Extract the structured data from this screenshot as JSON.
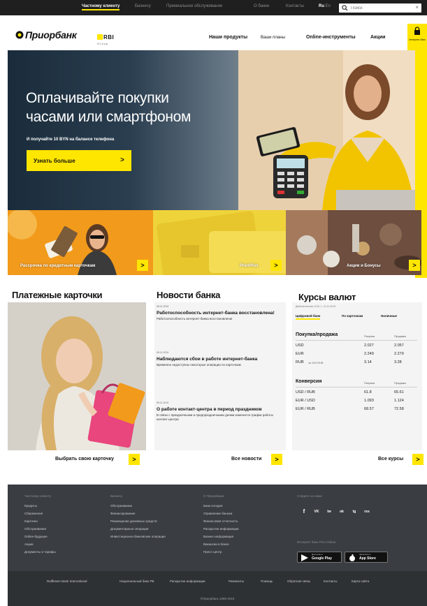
{
  "topbar": {
    "links": [
      "Частному клиенту",
      "Бизнесу",
      "Премиальное обслуживание",
      "О банке",
      "Контакты"
    ],
    "lang": [
      "Ru",
      "En"
    ],
    "search_placeholder": "Поиск",
    "close": "×"
  },
  "brand": {
    "name": "Приорбанк",
    "partner": "RBI",
    "partner_sub": "Group"
  },
  "nav": {
    "items": [
      "Наши продукты",
      "Ваши планы",
      "Online-инструменты",
      "Акции"
    ],
    "cabinet": "Интернет-банк"
  },
  "hero": {
    "title_line1": "Оплачивайте покупки",
    "title_line2": "часами или смартфоном",
    "subtitle": "И получайте 10 BYN на балансе телефона",
    "cta": "Узнать больше",
    "arrow": ">"
  },
  "tiles": [
    {
      "label": "Рассрочка по кредитным карточкам",
      "arrow": ">"
    },
    {
      "label": "PriorPlus",
      "arrow": ">"
    },
    {
      "label": "Акции и Бонусы",
      "arrow": ">"
    }
  ],
  "cards": {
    "title": "Платежные карточки",
    "link": "Выбрать свою карточку",
    "arrow": ">"
  },
  "news": {
    "title": "Новости банка",
    "items": [
      {
        "date": "06.11.2019",
        "title": "Работоспособность интернет-банка восстановлена!",
        "text": "Работоспособность интернет-банка восстановлена!"
      },
      {
        "date": "06.11.2019",
        "title": "Наблюдаются сбои в работе интернет-банка",
        "text": "Временно недоступны некоторые операции по карточкам"
      },
      {
        "date": "05.11.2019",
        "title": "О работе контакт-центра в период праздников",
        "text": "В связи с праздничными и предпраздничными днями изменится график работы контакт-центра"
      }
    ],
    "link": "Все новости",
    "arrow": ">"
  },
  "rates": {
    "title": "Курсы валют",
    "updated": "Действительны: 8:30, 1, 10.11.2019",
    "tabs": [
      "Цифровой банк",
      "По карточкам",
      "Наличные"
    ],
    "buy_sell": {
      "head": "Покупка/продажа",
      "col_buy": "Покупка",
      "col_sell": "Продажа",
      "rows": [
        {
          "cur": "USD",
          "note": "",
          "buy": "2.027",
          "sell": "2.057"
        },
        {
          "cur": "EUR",
          "note": "",
          "buy": "2.249",
          "sell": "2.279"
        },
        {
          "cur": "RUB",
          "note": "за 100 RUB",
          "buy": "3.14",
          "sell": "3.28"
        }
      ]
    },
    "conversion": {
      "head": "Конверсия",
      "col_buy": "Покупка",
      "col_sell": "Продажа",
      "rows": [
        {
          "pair": "USD / RUB",
          "buy": "61.8",
          "sell": "65.61"
        },
        {
          "pair": "EUR / USD",
          "buy": "1.093",
          "sell": "1.124"
        },
        {
          "pair": "EUR / RUB",
          "buy": "68.57",
          "sell": "72.58"
        }
      ]
    },
    "link": "Все курсы",
    "arrow": ">"
  },
  "footer": {
    "col1": {
      "head": "Частному клиенту",
      "links": [
        "Кредиты",
        "Сбережения",
        "Карточки",
        "Обслуживание",
        "Online-будущее",
        "Акции",
        "Документы и тарифы"
      ]
    },
    "col2": {
      "head": "Бизнесу",
      "links": [
        "Обслуживание",
        "Финансирование",
        "Размещение денежных средств",
        "Документарные операции",
        "Инвестиционно-банковские операции"
      ]
    },
    "col3": {
      "head": "О Приорбанке",
      "links": [
        "Банк сегодня",
        "Управление банком",
        "Финансовая отчетность",
        "Раскрытие информации",
        "Бизнес-информация",
        "Вакансии в банке",
        "Пресс-центр"
      ]
    },
    "col4": {
      "head": "Следите за нами",
      "apps_head": "Интернет банк Prior Online",
      "social": [
        "f",
        "VK",
        "tw",
        "ok",
        "tg",
        "rss"
      ]
    },
    "stores": [
      {
        "small": "Доступно в",
        "big": "Google Play"
      },
      {
        "small": "Загрузите в",
        "big": "App Store"
      }
    ],
    "bottom_links": [
      "Raiffeisen Bank International",
      "Национальный банк РБ",
      "Раскрытие информации",
      "Реквизиты",
      "Помощь",
      "Обратная связь",
      "Контакты",
      "Карта сайта"
    ],
    "copyright": "©Приорбанк 1999-2019"
  },
  "colors": {
    "accent": "#ffe600",
    "dark": "#1f1f1f",
    "footer": "#3a3d41"
  }
}
